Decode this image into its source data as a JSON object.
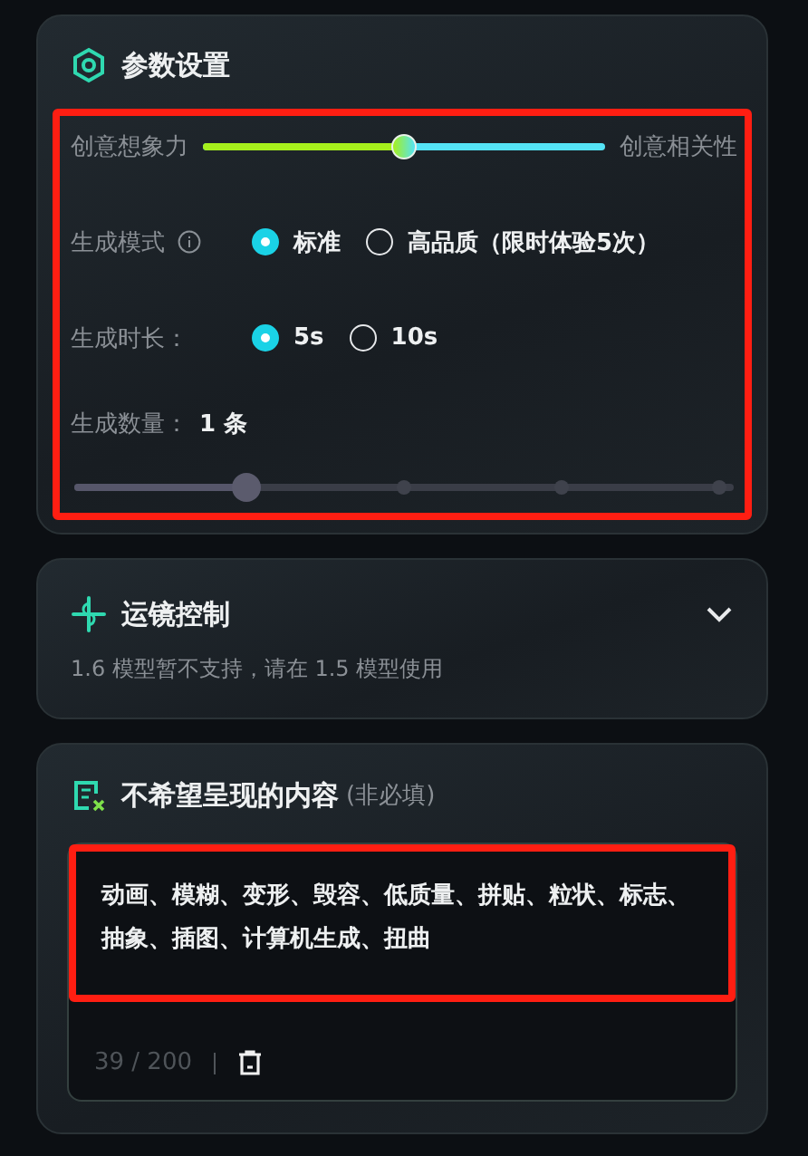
{
  "params": {
    "title": "参数设置",
    "creativity": {
      "left_label": "创意想象力",
      "right_label": "创意相关性",
      "level": 0.5
    },
    "mode": {
      "label": "生成模式",
      "options": [
        {
          "label": "标准",
          "selected": true
        },
        {
          "label": "高品质（限时体验5次）",
          "selected": false
        }
      ]
    },
    "duration": {
      "label": "生成时长：",
      "options": [
        {
          "label": "5s",
          "selected": true
        },
        {
          "label": "10s",
          "selected": false
        }
      ]
    },
    "quantity": {
      "label": "生成数量：",
      "value": "1 条",
      "level": 0.25
    }
  },
  "camera": {
    "title": "运镜控制",
    "expanded": false,
    "note": "1.6 模型暂不支持，请在 1.5 模型使用"
  },
  "negative": {
    "title": "不希望呈现的内容",
    "hint": "(非必填)",
    "value": "动画、模糊、变形、毁容、低质量、拼贴、粒状、标志、抽象、插图、计算机生成、扭曲",
    "counter": "39 / 200"
  }
}
